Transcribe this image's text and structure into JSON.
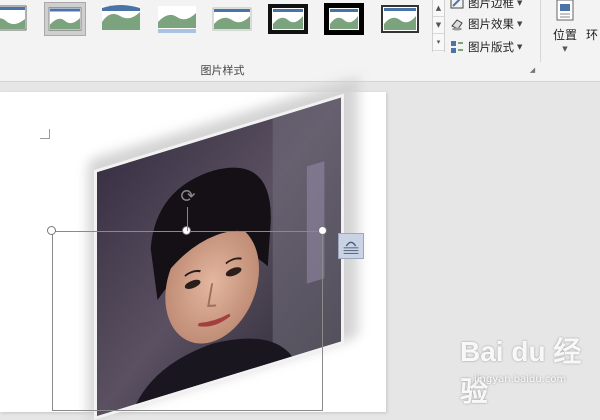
{
  "ribbon": {
    "picture_styles_group_label": "图片样式",
    "commands": {
      "picture_border": "图片边框",
      "picture_effects": "图片效果",
      "picture_layout": "图片版式"
    },
    "position_label": "位置",
    "wrap_text_truncated": "环"
  },
  "watermark": {
    "brand_text": "Bai du 经验",
    "url_text": "jingyan.baidu.com"
  },
  "colors": {
    "ribbon_bg": "#f3f3f3",
    "doc_bg": "#e6e6e6",
    "accent_blue": "#4a73a8",
    "hill_green": "#7aa37e"
  },
  "icons": {
    "rotate_handle": "rotate-icon",
    "layout_options": "layout-options-icon",
    "position": "position-icon"
  }
}
